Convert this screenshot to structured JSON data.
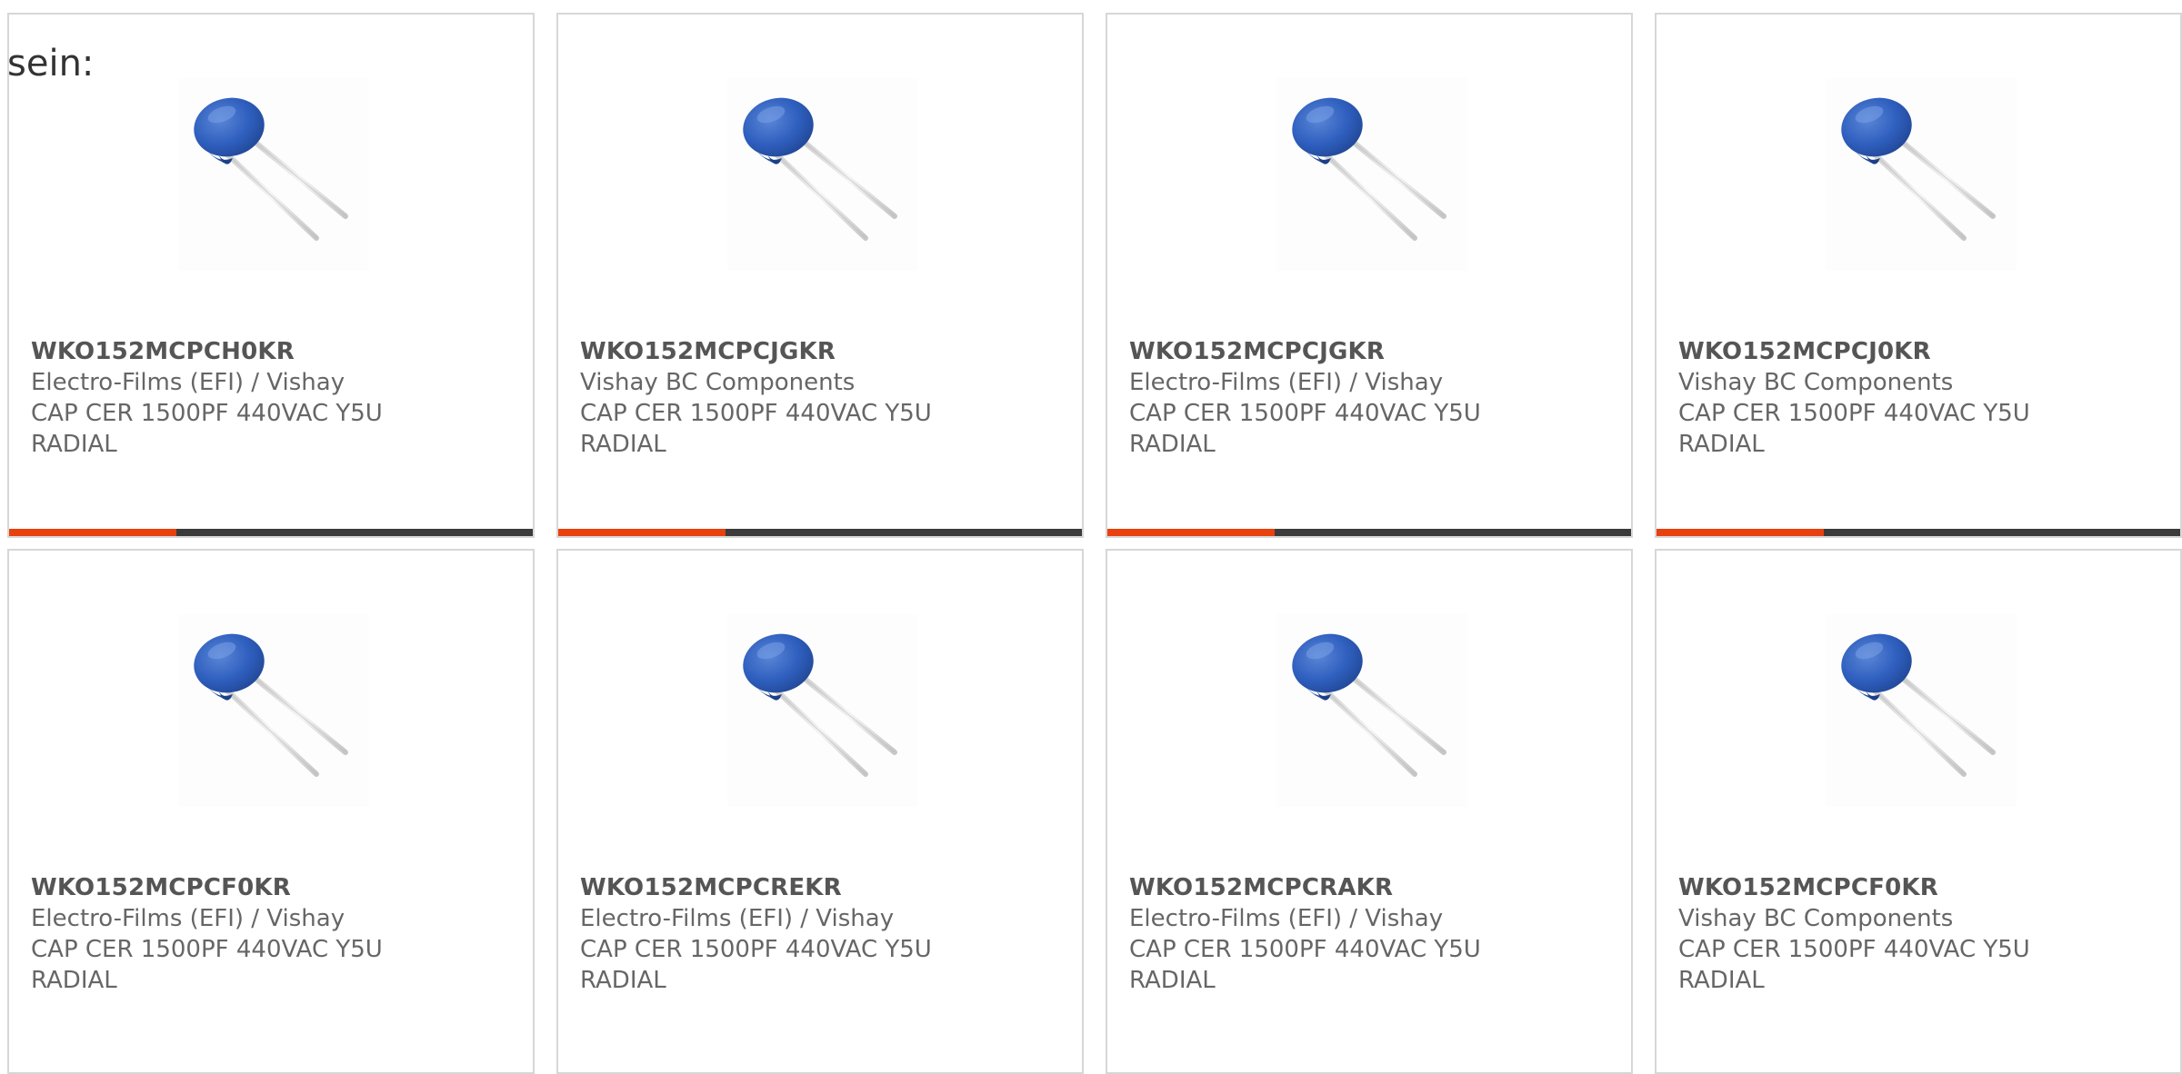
{
  "intro": "sein:",
  "accent_color": "#e8410f",
  "bar_color": "#3b3b3b",
  "product_image_icon": "radial-disc-capacitor-icon",
  "products": [
    {
      "part_number": "WKO152MCPCH0KR",
      "manufacturer": "Electro-Films (EFI) / Vishay",
      "description_line1": "CAP CER 1500PF 440VAC Y5U",
      "description_line2": "RADIAL",
      "progress": 0.32
    },
    {
      "part_number": "WKO152MCPCJGKR",
      "manufacturer": "Vishay BC Components",
      "description_line1": "CAP CER 1500PF 440VAC Y5U",
      "description_line2": "RADIAL",
      "progress": 0.32
    },
    {
      "part_number": "WKO152MCPCJGKR",
      "manufacturer": "Electro-Films (EFI) / Vishay",
      "description_line1": "CAP CER 1500PF 440VAC Y5U",
      "description_line2": "RADIAL",
      "progress": 0.32
    },
    {
      "part_number": "WKO152MCPCJ0KR",
      "manufacturer": "Vishay BC Components",
      "description_line1": "CAP CER 1500PF 440VAC Y5U",
      "description_line2": "RADIAL",
      "progress": 0.32
    },
    {
      "part_number": "WKO152MCPCF0KR",
      "manufacturer": "Electro-Films (EFI) / Vishay",
      "description_line1": "CAP CER 1500PF 440VAC Y5U",
      "description_line2": "RADIAL",
      "progress": null
    },
    {
      "part_number": "WKO152MCPCREKR",
      "manufacturer": "Electro-Films (EFI) / Vishay",
      "description_line1": "CAP CER 1500PF 440VAC Y5U",
      "description_line2": "RADIAL",
      "progress": null
    },
    {
      "part_number": "WKO152MCPCRAKR",
      "manufacturer": "Electro-Films (EFI) / Vishay",
      "description_line1": "CAP CER 1500PF 440VAC Y5U",
      "description_line2": "RADIAL",
      "progress": null
    },
    {
      "part_number": "WKO152MCPCF0KR",
      "manufacturer": "Vishay BC Components",
      "description_line1": "CAP CER 1500PF 440VAC Y5U",
      "description_line2": "RADIAL",
      "progress": null
    }
  ]
}
